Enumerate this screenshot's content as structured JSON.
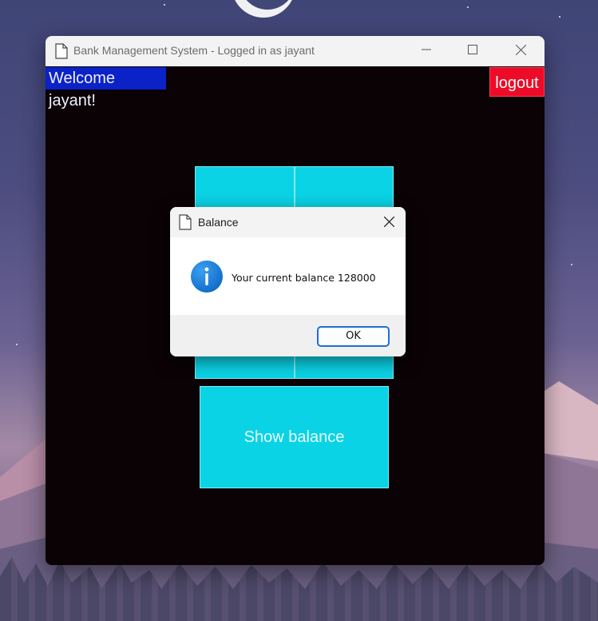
{
  "window": {
    "title": "Bank Management System - Logged in as jayant",
    "controls": [
      "minimize-icon",
      "maximize-icon",
      "close-icon"
    ]
  },
  "header": {
    "welcome_text": "Welcome jayant!",
    "logout_label": "logout"
  },
  "main": {
    "tiles": [
      {
        "label": ""
      },
      {
        "label": ""
      }
    ],
    "show_balance_label": "Show balance"
  },
  "dialog": {
    "title": "Balance",
    "message": "Your current balance 128000",
    "ok_label": "OK",
    "icon": "info-icon"
  },
  "colors": {
    "welcome_bg": "#0a22c8",
    "logout_bg": "#ee0b27",
    "tile_bg": "#0bd3e6",
    "content_bg": "#0a0204",
    "ok_border": "#1f6fd0"
  }
}
